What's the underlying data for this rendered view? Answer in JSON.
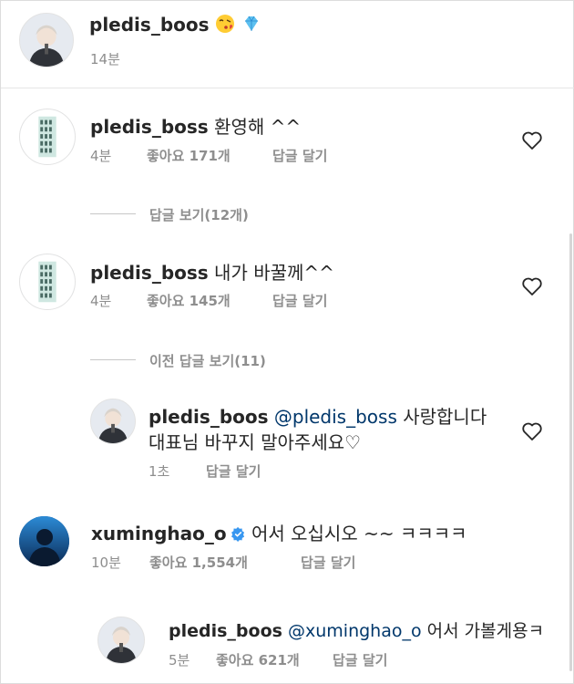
{
  "post": {
    "username": "pledis_boos",
    "time": "14분",
    "emoji_icons": [
      "kiss-face-icon",
      "blue-diamond-icon"
    ]
  },
  "comments": [
    {
      "username": "pledis_boss",
      "text": " 환영해 ^^",
      "time": "4분",
      "likes": "좋아요 171개",
      "reply": "답글 달기",
      "view_replies": "답글 보기(12개)"
    },
    {
      "username": "pledis_boss",
      "text": " 내가 바꿀께^^",
      "time": "4분",
      "likes": "좋아요 145개",
      "reply": "답글 달기",
      "view_replies": "이전 답글 보기(11)",
      "reply_item": {
        "username": "pledis_boos",
        "mention": "@pledis_boss",
        "text_line1": " 사랑합니다",
        "text_line2": "대표님 바꾸지 말아주세요♡",
        "time": "1초",
        "reply": "답글 달기"
      }
    },
    {
      "username": "xuminghao_o",
      "text": " 어서 오십시오 ~~ ㅋㅋㅋㅋ",
      "time": "10분",
      "likes": "좋아요 1,554개",
      "reply": "답글 달기",
      "reply_item": {
        "username": "pledis_boos",
        "mention": "@xuminghao_o",
        "text": " 어서 가볼게용ㅋ",
        "time": "5분",
        "likes": "좋아요 621개",
        "reply": "답글 달기"
      }
    }
  ],
  "colors": {
    "text": "#262626",
    "meta": "#8e8e8e",
    "mention": "#00376b",
    "verified": "#3897f0"
  }
}
